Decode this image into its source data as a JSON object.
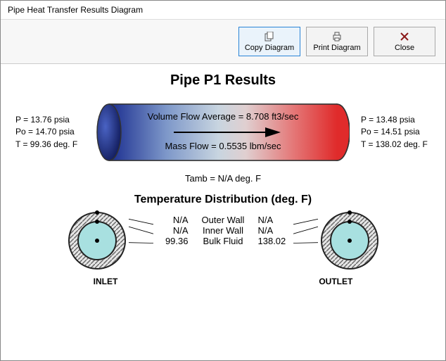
{
  "window": {
    "title": "Pipe Heat Transfer Results Diagram"
  },
  "toolbar": {
    "copy_label": "Copy Diagram",
    "print_label": "Print Diagram",
    "close_label": "Close"
  },
  "diagram": {
    "title": "Pipe P1 Results",
    "inlet": {
      "p_line": "P = 13.76 psia",
      "po_line": "Po = 14.70 psia",
      "t_line": "T = 99.36 deg. F"
    },
    "outlet": {
      "p_line": "P = 13.48 psia",
      "po_line": "Po = 14.51 psia",
      "t_line": "T = 138.02 deg. F"
    },
    "center": {
      "volume_flow": "Volume Flow Average = 8.708 ft3/sec",
      "mass_flow": "Mass Flow = 0.5535 lbm/sec"
    },
    "tamb_line": "Tamb = N/A deg. F"
  },
  "distribution": {
    "title": "Temperature Distribution (deg. F)",
    "rows": [
      {
        "inlet": "N/A",
        "label": "Outer Wall",
        "outlet": "N/A"
      },
      {
        "inlet": "N/A",
        "label": "Inner Wall",
        "outlet": "N/A"
      },
      {
        "inlet": "99.36",
        "label": "Bulk Fluid",
        "outlet": "138.02"
      }
    ],
    "inlet_label": "INLET",
    "outlet_label": "OUTLET"
  }
}
